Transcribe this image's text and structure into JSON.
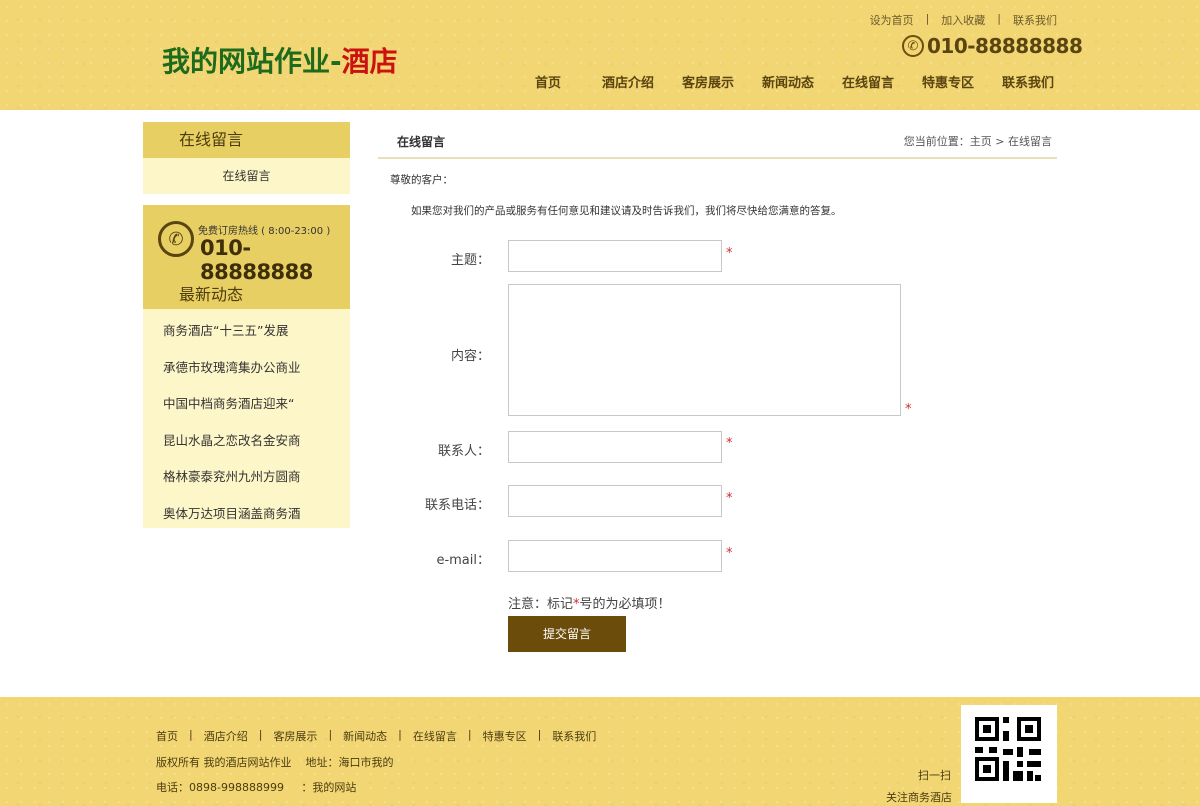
{
  "header": {
    "logo_part1": "我的网站作业-",
    "logo_part2": "酒店",
    "top_links": [
      "设为首页",
      "加入收藏",
      "联系我们"
    ],
    "phone": "010-88888888",
    "nav": [
      "首页",
      "酒店介绍",
      "客房展示",
      "新闻动态",
      "在线留言",
      "特惠专区",
      "联系我们"
    ]
  },
  "sidebar": {
    "section_title": "在线留言",
    "section_item": "在线留言",
    "hotline_label": "免费订房热线 ( 8:00-23:00 )",
    "hotline_number": "010-88888888",
    "news_title": "最新动态",
    "news": [
      "商务酒店“十三五”发展",
      "承德市玫瑰湾集办公商业",
      "中国中档商务酒店迎来“",
      "昆山水晶之恋改名金安商",
      "格林豪泰兖州九州方圆商",
      "奥体万达项目涵盖商务酒"
    ]
  },
  "main": {
    "title": "在线留言",
    "breadcrumb": "您当前位置：主页 > 在线留言",
    "greeting": "尊敬的客户：",
    "intro": "如果您对我们的产品或服务有任何意见和建议请及时告诉我们，我们将尽快给您满意的答复。",
    "form": {
      "subject_label": "主题：",
      "content_label": "内容：",
      "contact_label": "联系人：",
      "phone_label": "联系电话：",
      "email_label": "e-mail：",
      "required_mark": "*",
      "note_prefix": "注意：标记",
      "note_star": "*",
      "note_suffix": "号的为必填项！",
      "submit_label": "提交留言"
    }
  },
  "footer": {
    "nav": [
      "首页",
      "酒店介绍",
      "客房展示",
      "新闻动态",
      "在线留言",
      "特惠专区",
      "联系我们"
    ],
    "copyright": "版权所有 我的酒店网站作业    地址：海口市我的",
    "tel": "电话：0898-998888999     ：我的网站",
    "scan": "扫一扫",
    "follow": "关注商务酒店"
  },
  "colors": {
    "gold": "#f2d673",
    "sidebar_head": "#e8cf63",
    "sidebar_body": "#fdf6c8",
    "button": "#6b4c0b",
    "required": "#d42a2a"
  }
}
